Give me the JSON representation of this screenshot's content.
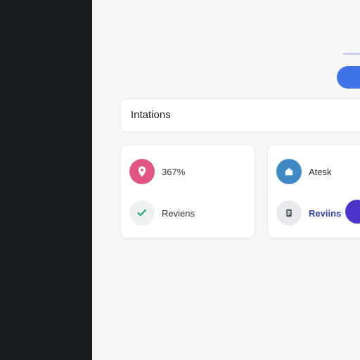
{
  "section": {
    "title": "Intations"
  },
  "cards": [
    {
      "row1": {
        "text": "367%",
        "icon": "location-pin-icon",
        "color": "#e05584"
      },
      "row2": {
        "text": "Reviens",
        "icon": "check-icon",
        "color": "#2ea36a"
      }
    },
    {
      "row1": {
        "text": "Atesk",
        "icon": "home-icon",
        "color": "#3f8ac4"
      },
      "row2": {
        "text": "Reviins",
        "icon": "document-icon",
        "color": "#4b4f59"
      }
    }
  ],
  "colors": {
    "sidebar": "#181b1f",
    "primary": "#3f73e6",
    "toggle": "#4a35c8"
  }
}
